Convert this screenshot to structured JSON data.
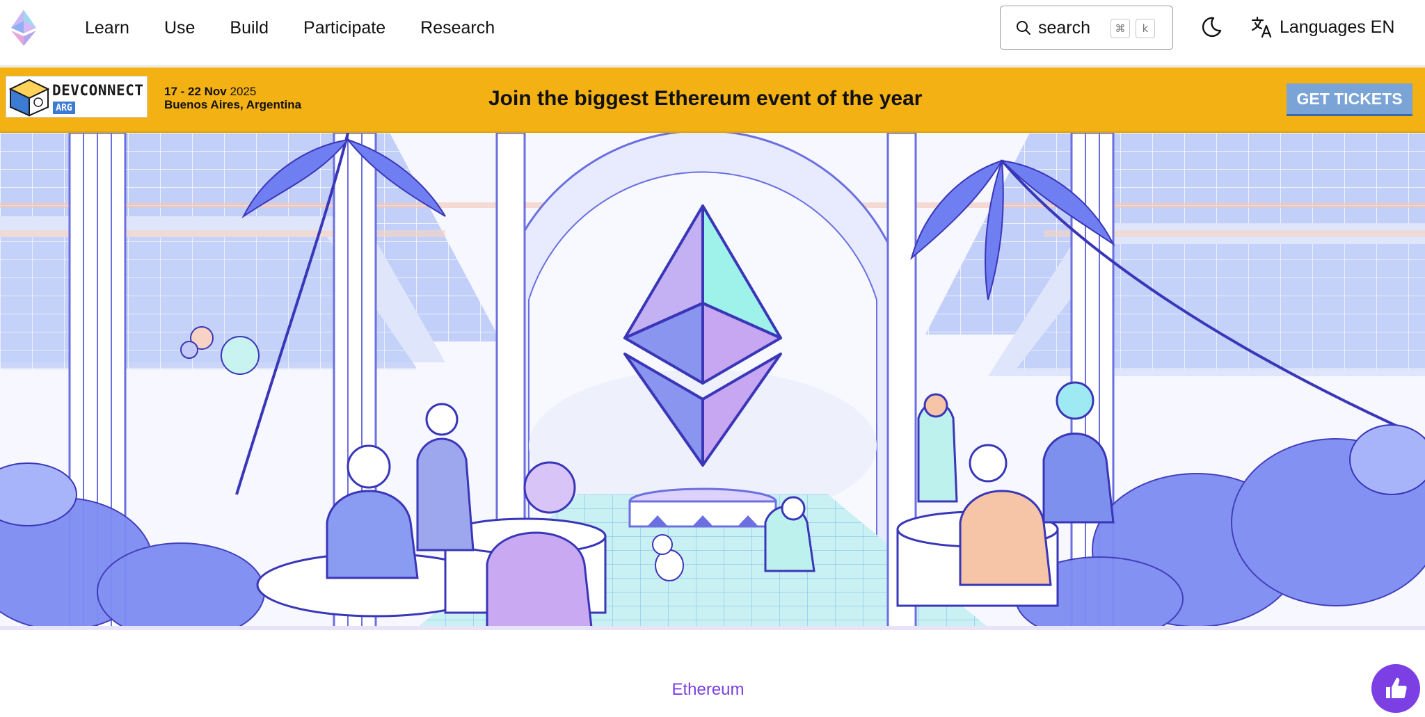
{
  "nav": {
    "links": [
      "Learn",
      "Use",
      "Build",
      "Participate",
      "Research"
    ],
    "search": {
      "label": "search",
      "shortcut_cmd": "⌘",
      "shortcut_key": "k"
    },
    "language": {
      "label": "Languages EN"
    }
  },
  "banner": {
    "logo_word": "DEVCONNECT",
    "logo_badge": "ARG",
    "dates_bold": "17 - 22 Nov",
    "dates_year": "2025",
    "location": "Buenos Aires, Argentina",
    "headline": "Join the biggest Ethereum event of the year",
    "cta": "GET TICKETS",
    "background": "#f3b114"
  },
  "breadcrumb": {
    "label": "Ethereum"
  },
  "colors": {
    "accent": "#7b3fe4",
    "hero_blue": "#6f7ef0",
    "hero_teal": "#8ff0e6"
  },
  "icons": {
    "logo": "ethereum-logo-icon",
    "search": "search-icon",
    "theme": "moon-icon",
    "language": "translate-icon",
    "feedback": "thumbs-up-icon"
  }
}
